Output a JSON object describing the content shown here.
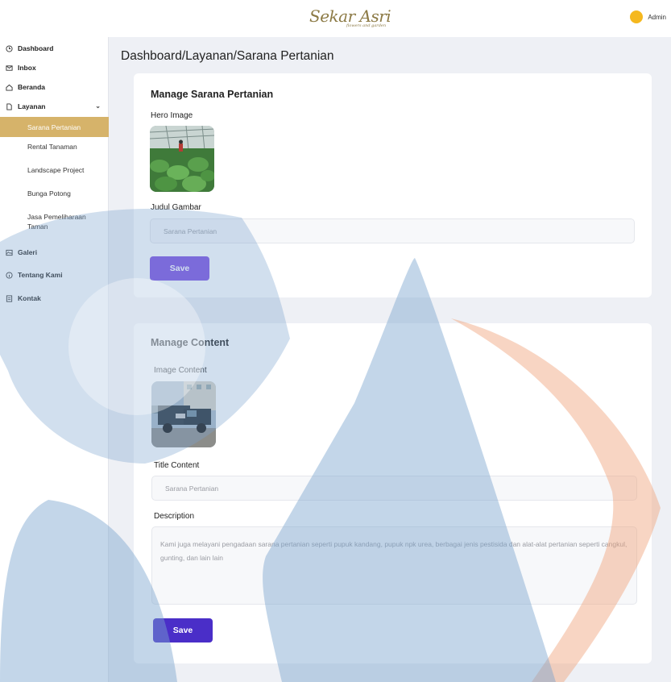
{
  "header": {
    "logo_text": "Sekar Asri",
    "logo_tagline": "flowers and garden",
    "user_name": "Admin",
    "avatar_color": "#f5b81e"
  },
  "sidebar": {
    "items": [
      {
        "label": "Dashboard",
        "icon": "clock-icon"
      },
      {
        "label": "Inbox",
        "icon": "mail-icon"
      },
      {
        "label": "Beranda",
        "icon": "home-icon"
      },
      {
        "label": "Layanan",
        "icon": "document-icon"
      },
      {
        "label": "Galeri",
        "icon": "image-icon"
      },
      {
        "label": "Tentang Kami",
        "icon": "info-icon"
      },
      {
        "label": "Kontak",
        "icon": "contact-icon"
      }
    ],
    "sub_items": [
      {
        "label": "Sarana Pertanian",
        "active": true
      },
      {
        "label": "Rental Tanaman"
      },
      {
        "label": "Landscape Project"
      },
      {
        "label": "Bunga Potong"
      },
      {
        "label": "Jasa Pemeliharaan Taman"
      }
    ],
    "active_color": "#d6b36a"
  },
  "breadcrumb": "Dashboard/Layanan/Sarana Pertanian",
  "hero_card": {
    "title": "Manage Sarana Pertanian",
    "image_label": "Hero Image",
    "field_label": "Judul Gambar",
    "field_value": "Sarana Pertanian",
    "save_label": "Save"
  },
  "content_card": {
    "title": "Manage Content",
    "image_label": "Image Content",
    "title_label": "Title Content",
    "title_value": "Sarana Pertanian",
    "description_label": "Description",
    "description_value": "Kami juga melayani pengadaan sarana pertanian seperti pupuk kandang, pupuk npk urea, berbagai jenis pestisida dan alat-alat pertanian seperti cangkul, gunting, dan lain lain",
    "save_label": "Save"
  },
  "colors": {
    "primary_button": "#7b4ee0",
    "secondary_button": "#4a2ec8",
    "watermark_blue": "#7aa3cf",
    "watermark_orange": "#f0a27a"
  }
}
